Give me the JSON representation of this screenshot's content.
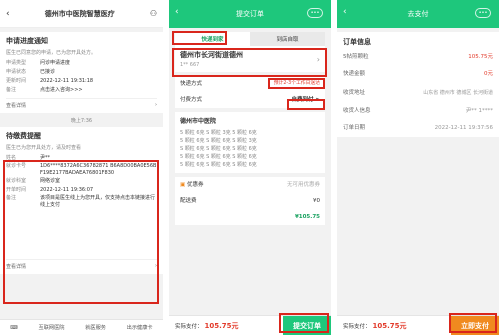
{
  "phone1": {
    "title": "德州市中医院智慧医疗",
    "notice_title": "申请进度通知",
    "notice_desc": "医生已同意您的申请，已为您开具处方。",
    "rows": [
      {
        "k": "申请类型",
        "v": "问诊申请进度"
      },
      {
        "k": "申请状态",
        "v": "已接诊"
      },
      {
        "k": "更新时间",
        "v": "2022-12-11 19:31:18"
      },
      {
        "k": "备注",
        "v": "点击进入咨询>>>"
      }
    ],
    "view_detail": "查看详情",
    "timestamp": "晚上7:36",
    "pay_title": "待缴费提醒",
    "pay_desc": "医生已为您开具处方，请及时查看",
    "pay_rows": [
      {
        "k": "姓名",
        "v": "尹**"
      },
      {
        "k": "就诊卡号",
        "v": "1D6****8372A6C36782871 B6A8D00BA0E56BF19E2177BADAEA76801F830"
      },
      {
        "k": "就诊科室",
        "v": "网络诊室"
      },
      {
        "k": "开单时间",
        "v": "2022-12-11 19:36:07"
      },
      {
        "k": "备注",
        "v": "该项目是医生线上为您开具，仅支持点击本链接进行线上支付"
      }
    ],
    "view_detail2": "查看详情",
    "nav": [
      "互联网医院",
      "就医服务",
      "出示健康卡"
    ]
  },
  "phone2": {
    "title": "提交订单",
    "tabs": [
      "快递到家",
      "到店自取"
    ],
    "address": "德州市长河街道德州",
    "address_sub": "1**   667",
    "delivery_label": "快递方式",
    "delivery_value": "预计2-3个工作日送达",
    "paytype_label": "付费方式",
    "paytype_value": "自费到付 >",
    "hospital": "德州市中医院",
    "meds": [
      "5 颗粒 6克  S 颗粒 3克  5 颗粒 6克",
      "5 颗粒 6克  S 颗粒 6克  S 颗粒 3克",
      "S 颗粒 6克  S 颗粒 6克  S 颗粒 6克",
      "5 颗粒 6克  S 颗粒 6克  S 颗粒 6克",
      "5 颗粒 6克  S 颗粒 6克  S 颗粒 6克"
    ],
    "coupon_label": "优惠券",
    "coupon_value": "无可用优惠券",
    "shipping_label": "配送费",
    "shipping_value": "¥0",
    "subtotal": "¥105.75",
    "pay_label": "实际支付：",
    "pay_amount": "105.75元",
    "submit": "提交订单"
  },
  "phone3": {
    "title": "去支付",
    "info_title": "订单信息",
    "rows": [
      {
        "k": "5帖煎颗粒",
        "v": "105.75元"
      },
      {
        "k": "快递金额",
        "v": "0元"
      },
      {
        "k": "收货地址",
        "v": "山东省 德州市 德城区 长河街道 "
      },
      {
        "k": "收货人信息",
        "v": "尹** 1****"
      },
      {
        "k": "订单日期",
        "v": "2022-12-11 19:37:56"
      }
    ],
    "pay_label": "实际支付：",
    "pay_amount": "105.75元",
    "paynow": "立即支付"
  },
  "colors": {
    "green": "#1ec77c",
    "red": "#d9261c",
    "orange": "#f08a1f"
  }
}
